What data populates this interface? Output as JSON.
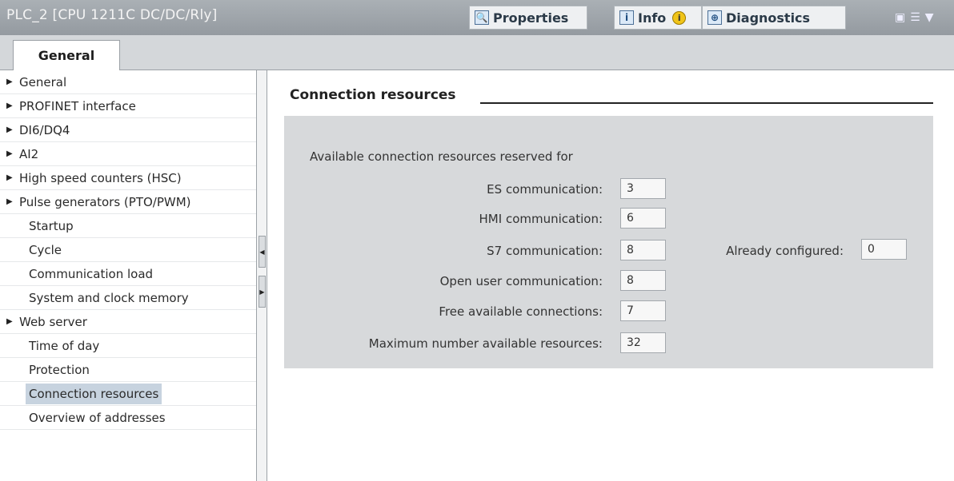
{
  "window": {
    "title": "PLC_2 [CPU 1211C DC/DC/Rly]",
    "tabs": {
      "properties": "Properties",
      "info": "Info",
      "diagnostics": "Diagnostics"
    }
  },
  "tabstrip": {
    "general": "General"
  },
  "nav": {
    "items": [
      {
        "label": "General",
        "arrow": true
      },
      {
        "label": "PROFINET interface",
        "arrow": true
      },
      {
        "label": "DI6/DQ4",
        "arrow": true
      },
      {
        "label": "AI2",
        "arrow": true
      },
      {
        "label": "High speed counters (HSC)",
        "arrow": true
      },
      {
        "label": "Pulse generators (PTO/PWM)",
        "arrow": true
      },
      {
        "label": "Startup",
        "arrow": false
      },
      {
        "label": "Cycle",
        "arrow": false
      },
      {
        "label": "Communication load",
        "arrow": false
      },
      {
        "label": "System and clock memory",
        "arrow": false
      },
      {
        "label": "Web server",
        "arrow": true
      },
      {
        "label": "Time of day",
        "arrow": false
      },
      {
        "label": "Protection",
        "arrow": false
      },
      {
        "label": "Connection resources",
        "arrow": false,
        "selected": true
      },
      {
        "label": "Overview of addresses",
        "arrow": false
      }
    ]
  },
  "content": {
    "section_title": "Connection resources",
    "panel_heading": "Available connection resources reserved for",
    "fields": {
      "es": {
        "label": "ES communication:",
        "value": "3"
      },
      "hmi": {
        "label": "HMI communication:",
        "value": "6"
      },
      "s7": {
        "label": "S7 communication:",
        "value": "8"
      },
      "open_user": {
        "label": "Open user communication:",
        "value": "8"
      },
      "free": {
        "label": "Free available connections:",
        "value": "7"
      },
      "max": {
        "label": "Maximum number available resources:",
        "value": "32"
      },
      "already": {
        "label": "Already configured:",
        "value": "0"
      }
    }
  }
}
